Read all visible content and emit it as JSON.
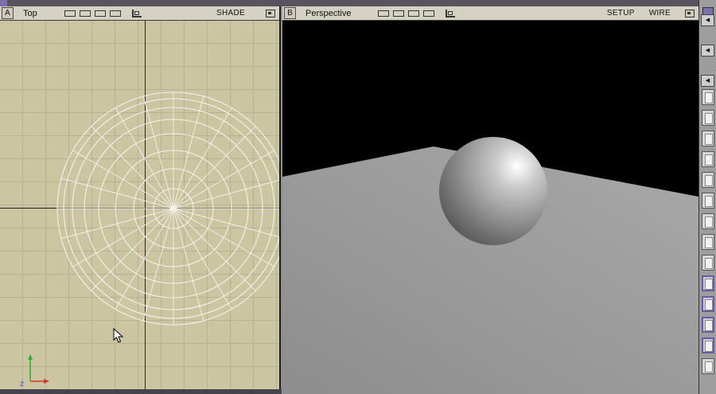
{
  "viewport_a": {
    "id": "A",
    "title": "Top",
    "shade_label": "SHADE"
  },
  "viewport_b": {
    "id": "B",
    "title": "Perspective",
    "setup_label": "SETUP",
    "wire_label": "WIRE"
  },
  "gizmo": {
    "z_label": "z"
  },
  "icons": {
    "arrow_left": "◀"
  },
  "colors": {
    "viewport_bg": "#cbc5a2",
    "grid_line": "#b7b193",
    "header_bg": "#d6d2c3",
    "ground_plane": "#9c9c9c",
    "accent_purple": "#7b6fae",
    "wireframe": "#f4f2ea",
    "axis_x_red": "#d23c2a",
    "axis_y_green": "#2fae2f",
    "axis_z_blue": "#3a55cc"
  }
}
